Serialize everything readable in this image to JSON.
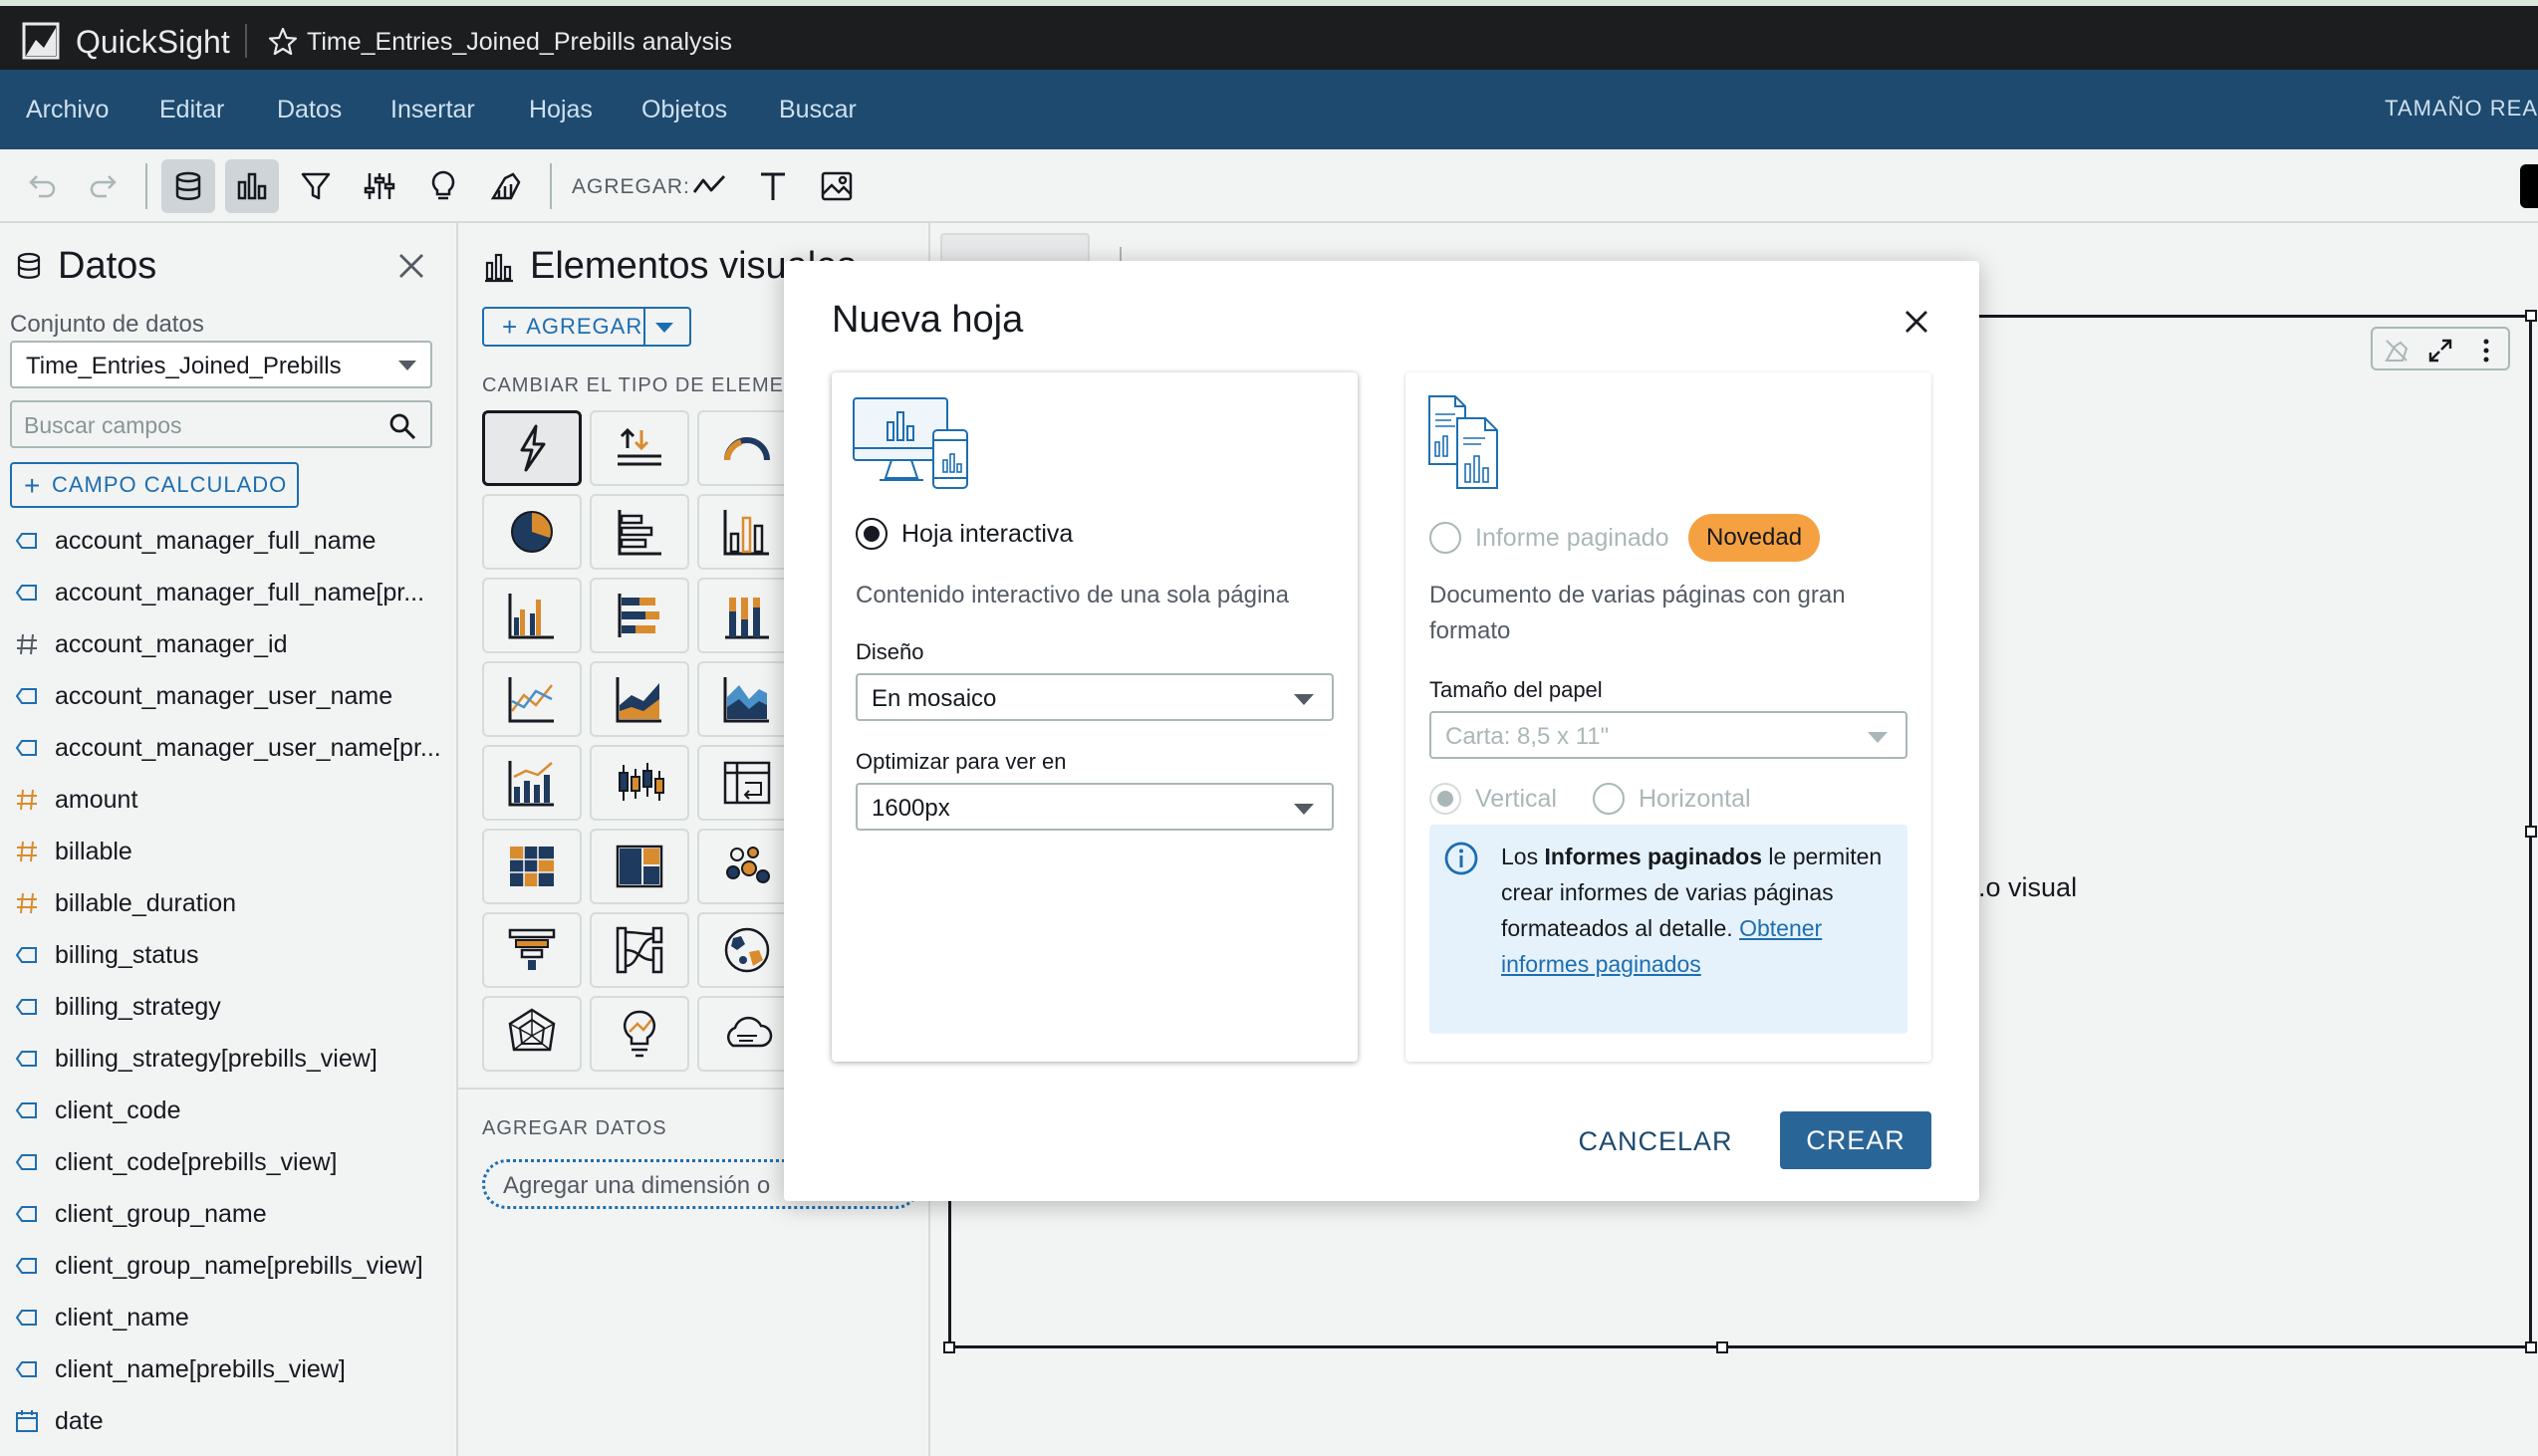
{
  "app": {
    "name": "QuickSight",
    "analysis_title": "Time_Entries_Joined_Prebills analysis"
  },
  "menu": {
    "items": [
      "Archivo",
      "Editar",
      "Datos",
      "Insertar",
      "Hojas",
      "Objetos",
      "Buscar"
    ],
    "size_label": "TAMAÑO REA"
  },
  "toolbar": {
    "add_label": "AGREGAR:",
    "icons": [
      "undo-icon",
      "redo-icon",
      "database-icon",
      "visuals-icon",
      "filter-icon",
      "parameters-icon",
      "insights-icon",
      "themes-icon",
      "line-chart-icon",
      "text-icon",
      "image-icon"
    ]
  },
  "data_panel": {
    "title": "Datos",
    "dataset_label": "Conjunto de datos",
    "dataset_value": "Time_Entries_Joined_Prebills",
    "search_placeholder": "Buscar campos",
    "calc_field_label": "CAMPO CALCULADO",
    "fields": [
      {
        "name": "account_manager_full_name",
        "type": "dimension"
      },
      {
        "name": "account_manager_full_name[pr...",
        "type": "dimension"
      },
      {
        "name": "account_manager_id",
        "type": "measure-id"
      },
      {
        "name": "account_manager_user_name",
        "type": "dimension"
      },
      {
        "name": "account_manager_user_name[pr...",
        "type": "dimension"
      },
      {
        "name": "amount",
        "type": "measure"
      },
      {
        "name": "billable",
        "type": "measure"
      },
      {
        "name": "billable_duration",
        "type": "measure"
      },
      {
        "name": "billing_status",
        "type": "dimension"
      },
      {
        "name": "billing_strategy",
        "type": "dimension"
      },
      {
        "name": "billing_strategy[prebills_view]",
        "type": "dimension"
      },
      {
        "name": "client_code",
        "type": "dimension"
      },
      {
        "name": "client_code[prebills_view]",
        "type": "dimension"
      },
      {
        "name": "client_group_name",
        "type": "dimension"
      },
      {
        "name": "client_group_name[prebills_view]",
        "type": "dimension"
      },
      {
        "name": "client_name",
        "type": "dimension"
      },
      {
        "name": "client_name[prebills_view]",
        "type": "dimension"
      },
      {
        "name": "date",
        "type": "date"
      }
    ]
  },
  "visuals_panel": {
    "title": "Elementos visuales",
    "add_label": "AGREGAR",
    "change_type_label": "CAMBIAR EL TIPO DE ELEMENTO",
    "add_data_label": "AGREGAR DATOS",
    "dimension_drop": "Agregar una dimensión o"
  },
  "canvas": {
    "hint_text": "o visual."
  },
  "modal": {
    "title": "Nueva hoja",
    "interactive": {
      "label": "Hoja interactiva",
      "description": "Contenido interactivo de una sola página",
      "layout_label": "Diseño",
      "layout_value": "En mosaico",
      "optimize_label": "Optimizar para ver en",
      "optimize_value": "1600px"
    },
    "paged": {
      "label": "Informe paginado",
      "badge": "Novedad",
      "description": "Documento de varias páginas con gran formato",
      "paper_label": "Tamaño del papel",
      "paper_value": "Carta: 8,5 x 11\"",
      "vertical_label": "Vertical",
      "horizontal_label": "Horizontal",
      "info_prefix": "Los ",
      "info_bold": "Informes paginados",
      "info_middle": " le permiten crear informes de varias páginas formateados al detalle. ",
      "info_link": "Obtener informes paginados"
    },
    "cancel_label": "CANCELAR",
    "create_label": "CREAR"
  },
  "colors": {
    "title_bar": "#1b1d1f",
    "menu_bar": "#1d4a6e",
    "accent": "#1d6eb0",
    "badge": "#f5a142",
    "primary_button": "#2a6597",
    "info_bg": "#e6f2fb"
  }
}
